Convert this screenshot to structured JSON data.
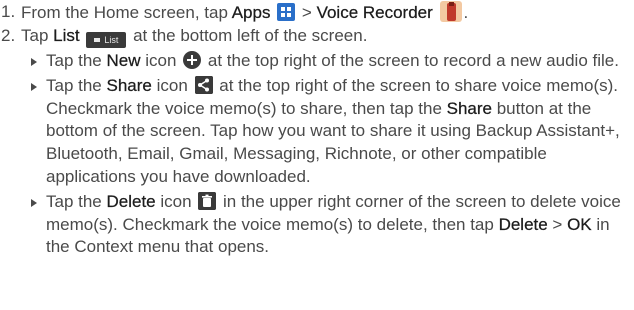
{
  "steps": [
    {
      "number": "1.",
      "text_before": "From the Home screen, tap ",
      "apps_label": "Apps",
      "apps_icon": "apps-grid-icon",
      "separator": " > ",
      "recorder_label": "Voice Recorder",
      "recorder_icon": "voice-recorder-icon",
      "text_after": "."
    },
    {
      "number": "2.",
      "text_before": "Tap ",
      "list_label": "List",
      "list_icon_text": "List",
      "text_after": " at the bottom left of the screen."
    }
  ],
  "bullets": {
    "new": {
      "pre": "Tap the ",
      "bold": "New",
      "mid": " icon ",
      "icon": "new-plus-icon",
      "post": " at the top right of the screen to record a new audio file."
    },
    "share": {
      "pre": "Tap the ",
      "bold": "Share",
      "mid": " icon ",
      "icon": "share-icon",
      "post": " at the top right of the screen to share voice memo(s). Checkmark the voice memo(s) to share, then tap the ",
      "bold2": "Share",
      "post2": " button at the bottom of the screen. Tap how you want to share it using Backup Assistant+, Bluetooth, Email, Gmail, Messaging, Richnote, or other compatible applications you have downloaded."
    },
    "delete": {
      "pre": "Tap the ",
      "bold": "Delete",
      "mid": " icon ",
      "icon": "trash-icon",
      "post": " in the upper right corner of the screen to delete voice memo(s). Checkmark the voice memo(s) to delete, then tap ",
      "bold2": "Delete",
      "sep": " > ",
      "bold3": "OK",
      "post2": " in the Context menu that opens."
    }
  },
  "colors": {
    "text": "#4a4a4a",
    "bold_text": "#1c1c1c",
    "apps_icon_blue": "#2a6fc9",
    "recorder_icon_red": "#c0392b"
  }
}
